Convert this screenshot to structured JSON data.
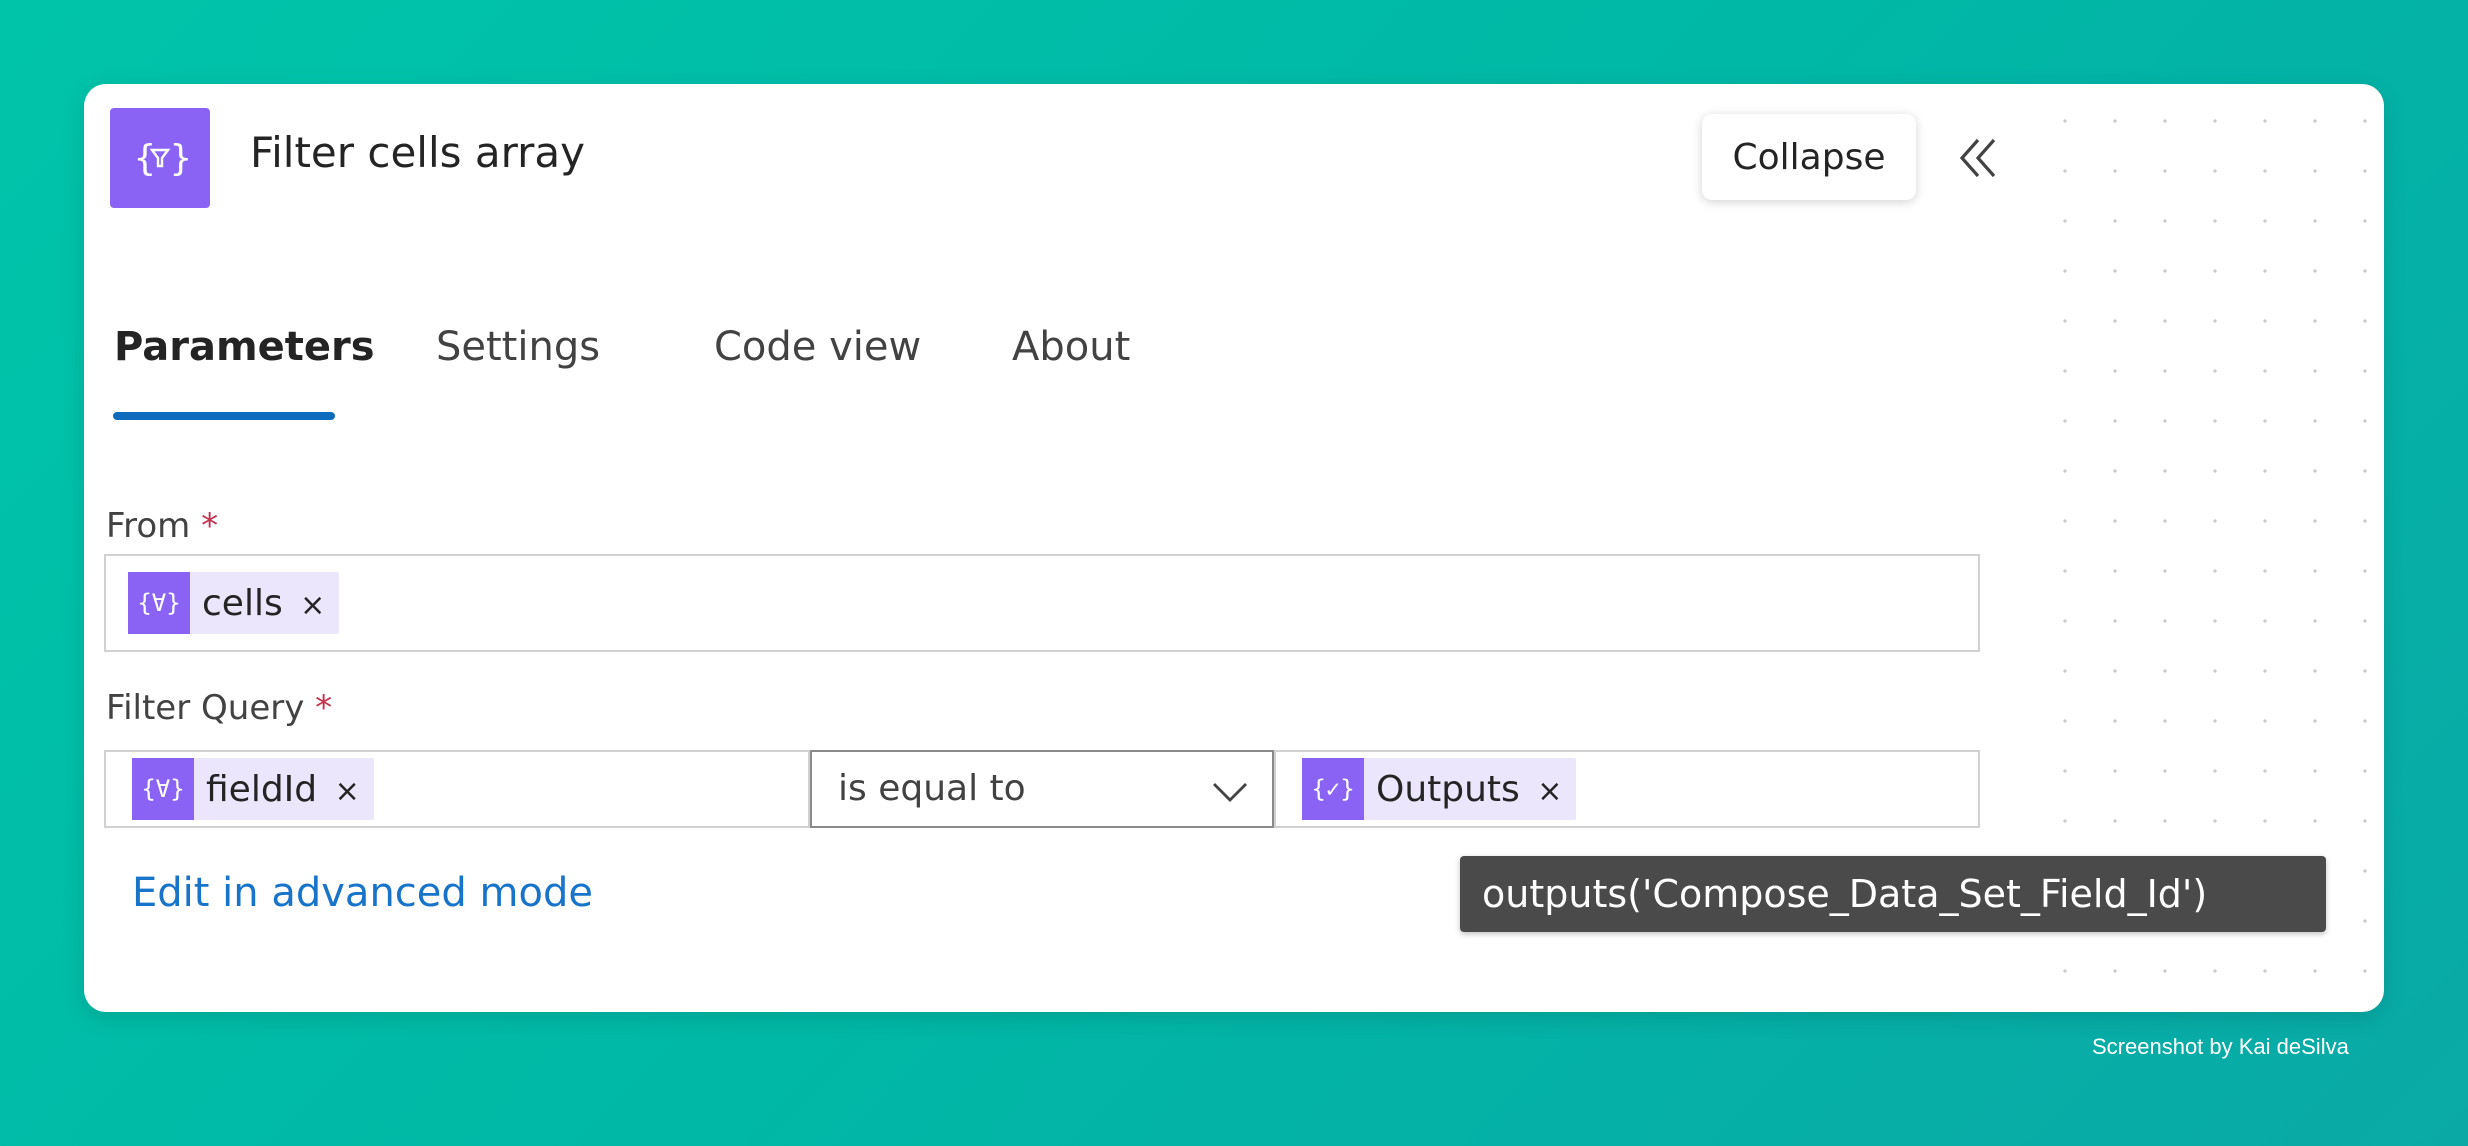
{
  "header": {
    "icon": "filter-array-icon",
    "title": "Filter cells array",
    "collapse_label": "Collapse",
    "collapse_icon": "double-chevron-left-icon"
  },
  "tabs": [
    {
      "label": "Parameters",
      "active": true
    },
    {
      "label": "Settings",
      "active": false
    },
    {
      "label": "Code view",
      "active": false
    },
    {
      "label": "About",
      "active": false
    }
  ],
  "from": {
    "label": "From",
    "required_mark": "*",
    "token": {
      "text": "cells",
      "remove": "×"
    }
  },
  "filter_query": {
    "label": "Filter Query",
    "required_mark": "*",
    "left_token": {
      "text": "fieldId",
      "remove": "×"
    },
    "operator": "is equal to",
    "right_token": {
      "text": "Outputs",
      "remove": "×"
    }
  },
  "advanced_link": "Edit in advanced mode",
  "tooltip": "outputs('Compose_Data_Set_Field_Id')",
  "credit": "Screenshot by Kai deSilva",
  "colors": {
    "accent": "#8a63f5",
    "token_bg": "#ece6fd",
    "tab_underline": "#0f6cbd",
    "link": "#1874c9",
    "required": "#c4314b",
    "tooltip_bg": "#4a4a4a"
  }
}
